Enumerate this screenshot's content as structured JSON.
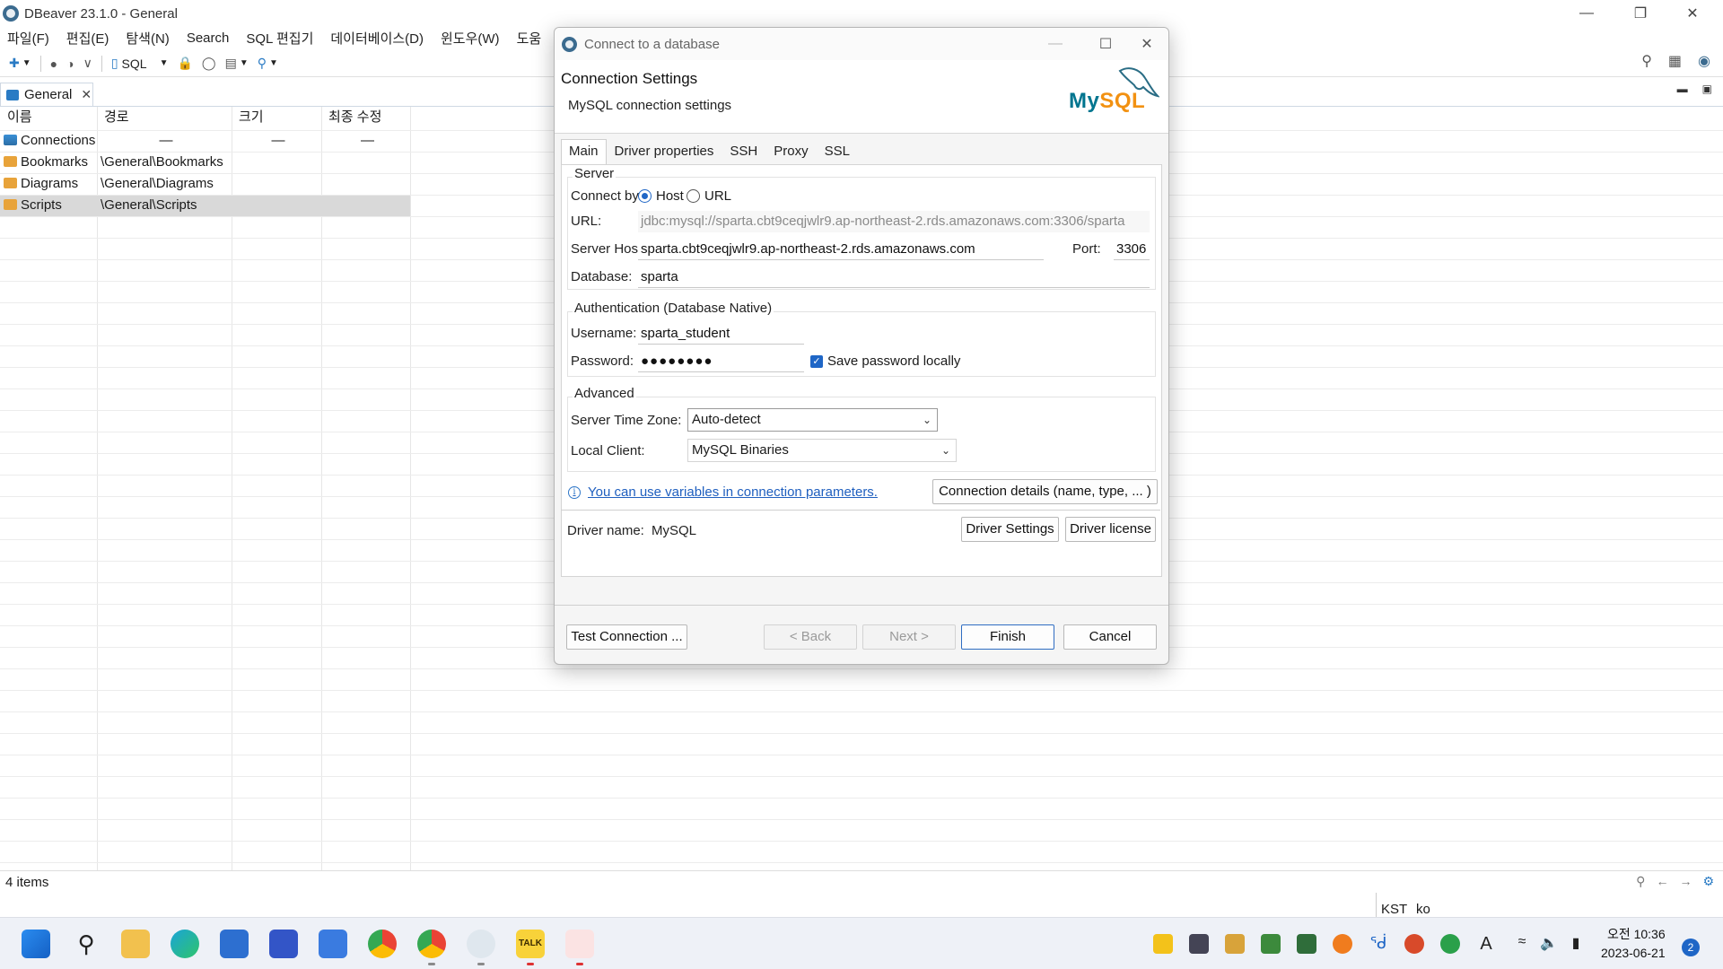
{
  "window": {
    "title": "DBeaver 23.1.0 - General"
  },
  "menu": [
    "파일(F)",
    "편집(E)",
    "탐색(N)",
    "Search",
    "SQL 편집기",
    "데이터베이스(D)",
    "윈도우(W)",
    "도움"
  ],
  "toolbar": {
    "sql_label": "SQL"
  },
  "editor": {
    "tab_label": "General",
    "columns": [
      "이름",
      "경로",
      "크기",
      "최종 수정"
    ],
    "rows": [
      {
        "name": "Connections",
        "path": "",
        "size": "—",
        "modified": "—",
        "icon": "connections-icon"
      },
      {
        "name": "Bookmarks",
        "path": "\\General\\Bookmarks",
        "size": "",
        "modified": "",
        "icon": "folder-icon"
      },
      {
        "name": "Diagrams",
        "path": "\\General\\Diagrams",
        "size": "",
        "modified": "",
        "icon": "folder-icon"
      },
      {
        "name": "Scripts",
        "path": "\\General\\Scripts",
        "size": "",
        "modified": "",
        "icon": "folder-icon"
      }
    ],
    "first_row_path_dash": "—"
  },
  "status": {
    "items": "4 items",
    "timezone": "KST",
    "locale": "ko"
  },
  "dialog": {
    "title": "Connect to a database",
    "header_title": "Connection Settings",
    "header_subtitle": "MySQL connection settings",
    "logo_my": "My",
    "logo_sql": "SQL",
    "tabs": [
      "Main",
      "Driver properties",
      "SSH",
      "Proxy",
      "SSL"
    ],
    "server": {
      "group_label": "Server",
      "connect_by_label": "Connect by:",
      "host_option": "Host",
      "url_option": "URL",
      "url_label": "URL:",
      "url_value": "jdbc:mysql://sparta.cbt9ceqjwlr9.ap-northeast-2.rds.amazonaws.com:3306/sparta",
      "host_label": "Server Host:",
      "host_value": "sparta.cbt9ceqjwlr9.ap-northeast-2.rds.amazonaws.com",
      "port_label": "Port:",
      "port_value": "3306",
      "database_label": "Database:",
      "database_value": "sparta"
    },
    "auth": {
      "group_label": "Authentication (Database Native)",
      "username_label": "Username:",
      "username_value": "sparta_student",
      "password_label": "Password:",
      "password_value": "●●●●●●●●",
      "save_password_label": "Save password locally"
    },
    "advanced": {
      "group_label": "Advanced",
      "timezone_label": "Server Time Zone:",
      "timezone_value": "Auto-detect",
      "client_label": "Local Client:",
      "client_value": "MySQL Binaries"
    },
    "variables_link": "You can use variables in connection parameters.",
    "connection_details_button": "Connection details (name, type, ... )",
    "driver_name_label": "Driver name:",
    "driver_name_value": "MySQL",
    "driver_settings_button": "Driver Settings",
    "driver_license_button": "Driver license",
    "buttons": {
      "test": "Test Connection ...",
      "back": "< Back",
      "next": "Next >",
      "finish": "Finish",
      "cancel": "Cancel"
    }
  },
  "taskbar": {
    "clock_period_time": "오전 10:36",
    "clock_date": "2023-06-21",
    "notification_count": "2",
    "kakao_label": "TALK",
    "input_indicator": "A"
  },
  "colors": {
    "accent": "#1f66c6",
    "mysql_blue": "#00758f",
    "mysql_orange": "#f29111",
    "selected_row": "#d9d9d9"
  }
}
